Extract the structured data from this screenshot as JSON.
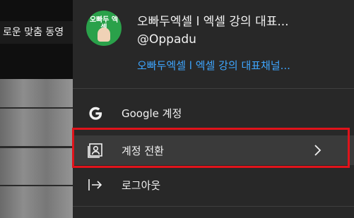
{
  "background": {
    "chip_text": "로운 맞춤 동영"
  },
  "account": {
    "name": "오빠두엑셀 l 엑셀 강의 대표...",
    "handle": "@Oppadu",
    "channel_link": "오빠두엑셀 l 엑셀 강의 대표채널...",
    "avatar_text": "오빠두 엑셀"
  },
  "menu": {
    "google_account": "Google 계정",
    "switch_account": "계정 전환",
    "sign_out": "로그아웃"
  },
  "colors": {
    "panel": "#282828",
    "link": "#3ea6ff",
    "highlight_border": "#e0131b"
  }
}
